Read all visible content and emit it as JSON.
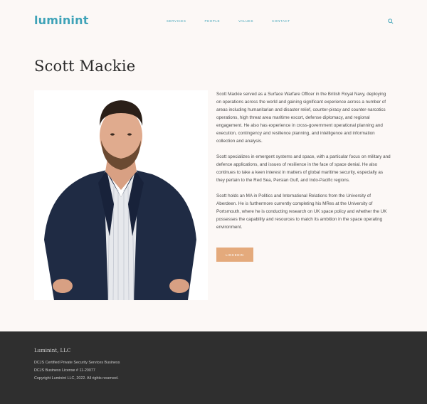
{
  "header": {
    "logo": "luminint",
    "nav": [
      {
        "label": "SERVICES"
      },
      {
        "label": "PEOPLE"
      },
      {
        "label": "VALUES"
      },
      {
        "label": "CONTACT"
      }
    ],
    "search_icon": "search-icon"
  },
  "main": {
    "title": "Scott Mackie",
    "photo_icon": "portrait-photo",
    "bio": [
      "Scott Mackie served as a Surface Warfare Officer in the British Royal Navy, deploying on operations across the world and gaining significant experience across a number of areas including humanitarian and disaster relief, counter-piracy and counter-narcotics operations, high threat area maritime escort, defense diplomacy, and regional engagement.  He also has experience in cross-government operational planning and execution, contingency and resilience planning, and intelligence and information collection and analysis.",
      "Scott specializes in emergent systems and space, with a particular focus on military and defence applications, and issues of resilience in the face of space denial.  He also continues to take a keen interest in matters of global maritime security, especially as they pertain to the Red Sea, Persian Gulf, and Indo-Pacific regions.",
      "Scott holds an MA in Politics and International Relations from the University of Aberdeen. He is furthermore currently completing his MRes at the University of Portsmouth, where he is conducting research on UK space policy and whether the UK possesses the capability and resources to match its ambition in the space operating environment."
    ],
    "linkedin_label": "LINKEDIN"
  },
  "footer": {
    "brand": "Luminint, LLC",
    "lines": [
      "DCJS Certified Private Security Services Business",
      "DCJS Business License # 11-20077",
      "Copyright Luminint LLC, 2022.  All rights reserved."
    ]
  },
  "colors": {
    "background": "#fcf8f6",
    "accent": "#3fa3b8",
    "button": "#e4aa7c",
    "footer": "#2f2f2f"
  }
}
